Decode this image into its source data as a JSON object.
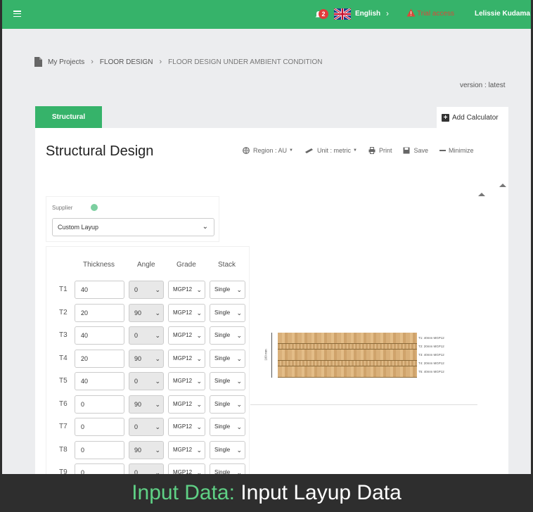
{
  "header": {
    "notifications_count": "2",
    "language": "English",
    "trial_status": "Trial access",
    "user_name": "Lelissie Kudama",
    "brand_color": "#36b36a"
  },
  "breadcrumb": {
    "items": [
      "My Projects",
      "FLOOR DESIGN",
      "FLOOR DESIGN UNDER AMBIENT CONDITION"
    ]
  },
  "version": "version : latest",
  "tabs": {
    "active": "Structural",
    "add_calculator": "Add Calculator"
  },
  "panel": {
    "title": "Structural Design",
    "toolbar": {
      "region": "Region : AU",
      "unit": "Unit : metric",
      "print": "Print",
      "save": "Save",
      "minimize": "Minimize"
    }
  },
  "supplier": {
    "label": "Supplier",
    "value": "Custom Layup"
  },
  "layup_table": {
    "headers": [
      "Thickness",
      "Angle",
      "Grade",
      "Stack"
    ],
    "rows": [
      {
        "label": "T1",
        "thickness": "40",
        "angle": "0",
        "grade": "MGP12",
        "stack": "Single"
      },
      {
        "label": "T2",
        "thickness": "20",
        "angle": "90",
        "grade": "MGP12",
        "stack": "Single"
      },
      {
        "label": "T3",
        "thickness": "40",
        "angle": "0",
        "grade": "MGP12",
        "stack": "Single"
      },
      {
        "label": "T4",
        "thickness": "20",
        "angle": "90",
        "grade": "MGP12",
        "stack": "Single"
      },
      {
        "label": "T5",
        "thickness": "40",
        "angle": "0",
        "grade": "MGP12",
        "stack": "Single"
      },
      {
        "label": "T6",
        "thickness": "0",
        "angle": "90",
        "grade": "MGP12",
        "stack": "Single"
      },
      {
        "label": "T7",
        "thickness": "0",
        "angle": "0",
        "grade": "MGP12",
        "stack": "Single"
      },
      {
        "label": "T8",
        "thickness": "0",
        "angle": "90",
        "grade": "MGP12",
        "stack": "Single"
      },
      {
        "label": "T9",
        "thickness": "0",
        "angle": "0",
        "grade": "MGP12",
        "stack": "Single"
      }
    ]
  },
  "layup_visual": {
    "total_height": "160 mm",
    "layer_labels": [
      "T1: 40mm MGP12",
      "T2: 20mm MGP12",
      "T3: 40mm MGP12",
      "T4: 20mm MGP12",
      "T5: 40mm MGP12"
    ]
  },
  "caption": {
    "label": "Input Data:",
    "text": "Input Layup Data"
  }
}
